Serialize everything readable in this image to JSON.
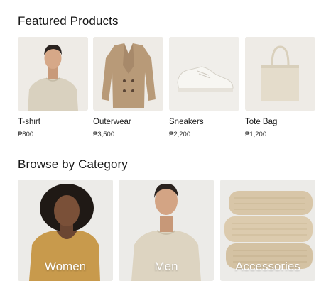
{
  "featured": {
    "title": "Featured Products",
    "products": [
      {
        "name": "T-shirt",
        "price": "₱800",
        "image_icon": "tshirt-model-image"
      },
      {
        "name": "Outerwear",
        "price": "₱3,500",
        "image_icon": "coat-image"
      },
      {
        "name": "Sneakers",
        "price": "₱2,200",
        "image_icon": "sneaker-image"
      },
      {
        "name": "Tote Bag",
        "price": "₱1,200",
        "image_icon": "tote-bag-image"
      }
    ]
  },
  "categories": {
    "title": "Browse by Category",
    "items": [
      {
        "label": "Women",
        "image_icon": "woman-model-image"
      },
      {
        "label": "Men",
        "image_icon": "man-model-image"
      },
      {
        "label": "Accessories",
        "image_icon": "folded-knit-image"
      }
    ]
  },
  "colors": {
    "card_bg": "#eeebe6",
    "text": "#1a1a1a",
    "label_overlay": "#ffffff"
  }
}
